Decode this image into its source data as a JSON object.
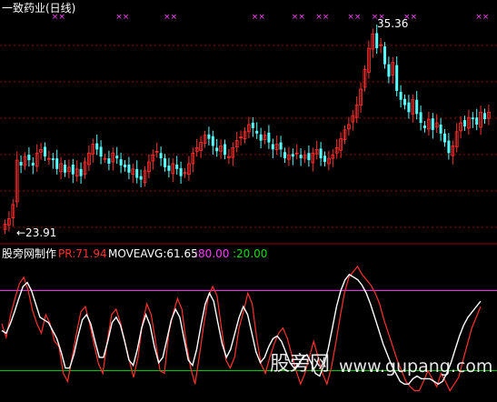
{
  "window": {
    "title": "一致药业(日线)"
  },
  "price_panel": {
    "high_label": "35.36",
    "low_label": "←23.91",
    "colors": {
      "up": "#ff3030",
      "down": "#54ffff",
      "grid": "#8b0000",
      "marker": "#ff40ff"
    }
  },
  "indicator_panel": {
    "name": "股旁网制作",
    "pr_text": "PR:71.94",
    "moveavg_text": "MOVEAVG:61.65",
    "level_high_text": ":80.00",
    "level_low_text": ":20.00",
    "colors": {
      "pr": "#ff3030",
      "moveavg": "#ffffff",
      "level_high": "#ff3cff",
      "level_low": "#00e000"
    }
  },
  "watermark": {
    "cn": "股旁网",
    "url": "www.gupang.com"
  },
  "chart_data": [
    {
      "type": "candlestick",
      "title": "一致药业(日线)",
      "ylim": [
        23.5,
        36.2
      ],
      "grid": true,
      "annotations": [
        {
          "text": "35.36",
          "kind": "high"
        },
        {
          "text": "←23.91",
          "kind": "low"
        }
      ],
      "signal_markers": "×× at top of panel",
      "series": [
        {
          "name": "close",
          "values": [
            24.3,
            24.6,
            25.4,
            27.9,
            27.6,
            28.1,
            27.9,
            27.6,
            28.3,
            28.5,
            28.1,
            28.0,
            27.9,
            27.4,
            27.7,
            27.2,
            27.5,
            27.1,
            27.4,
            27.0,
            27.8,
            28.3,
            28.8,
            28.5,
            28.1,
            28.0,
            27.7,
            28.3,
            28.0,
            27.6,
            27.5,
            27.2,
            27.4,
            26.9,
            26.8,
            27.3,
            27.8,
            28.2,
            28.4,
            28.0,
            27.5,
            27.3,
            27.7,
            27.4,
            27.0,
            27.2,
            27.7,
            28.3,
            28.6,
            28.9,
            29.3,
            29.1,
            28.7,
            28.4,
            28.7,
            28.2,
            28.1,
            28.6,
            29.0,
            29.2,
            29.5,
            29.9,
            29.7,
            29.4,
            29.0,
            29.3,
            28.9,
            28.5,
            28.8,
            28.5,
            28.0,
            28.2,
            28.1,
            28.3,
            28.0,
            28.2,
            27.9,
            28.3,
            28.5,
            28.0,
            27.8,
            28.0,
            28.2,
            28.6,
            29.1,
            29.6,
            29.9,
            30.4,
            31.0,
            31.9,
            33.0,
            34.2,
            35.0,
            34.2,
            34.4,
            33.3,
            32.6,
            33.4,
            31.8,
            31.3,
            31.0,
            30.6,
            31.3,
            30.5,
            30.0,
            29.7,
            30.2,
            29.6,
            30.0,
            29.4,
            28.9,
            28.3,
            28.7,
            29.5,
            30.0,
            29.8,
            30.3,
            30.2,
            29.9,
            30.6,
            30.2,
            30.6
          ]
        }
      ]
    },
    {
      "type": "line",
      "title": "股旁网制作",
      "ylim": [
        0,
        100
      ],
      "reference_lines": [
        80,
        20
      ],
      "series": [
        {
          "name": "PR",
          "values": [
            55,
            45,
            62,
            74,
            85,
            90,
            80,
            65,
            55,
            48,
            62,
            55,
            42,
            38,
            18,
            12,
            30,
            48,
            64,
            68,
            55,
            40,
            25,
            18,
            42,
            62,
            66,
            56,
            42,
            28,
            15,
            30,
            55,
            70,
            62,
            42,
            20,
            18,
            48,
            63,
            74,
            66,
            40,
            22,
            10,
            32,
            55,
            75,
            83,
            76,
            52,
            28,
            22,
            30,
            52,
            64,
            78,
            70,
            45,
            25,
            18,
            30,
            40,
            48,
            52,
            44,
            32,
            20,
            10,
            18,
            30,
            42,
            30,
            18,
            10,
            22,
            40,
            60,
            78,
            90,
            94,
            98,
            92,
            88,
            84,
            78,
            70,
            58,
            48,
            38,
            28,
            20,
            12,
            8,
            5,
            5,
            12,
            20,
            14,
            8,
            18,
            12,
            5,
            10,
            15,
            28,
            40,
            52,
            60,
            68
          ]
        },
        {
          "name": "MOVEAVG",
          "values": [
            50,
            48,
            55,
            64,
            74,
            83,
            86,
            80,
            70,
            60,
            58,
            56,
            50,
            44,
            34,
            22,
            22,
            32,
            46,
            58,
            62,
            55,
            42,
            30,
            30,
            42,
            56,
            60,
            54,
            42,
            28,
            24,
            36,
            52,
            62,
            54,
            38,
            26,
            30,
            44,
            58,
            66,
            60,
            44,
            28,
            24,
            36,
            54,
            70,
            78,
            72,
            56,
            40,
            30,
            36,
            48,
            60,
            68,
            62,
            48,
            34,
            26,
            30,
            38,
            44,
            46,
            42,
            34,
            26,
            22,
            24,
            30,
            32,
            26,
            18,
            16,
            24,
            36,
            52,
            68,
            80,
            88,
            92,
            90,
            88,
            84,
            78,
            70,
            60,
            50,
            40,
            32,
            24,
            18,
            12,
            10,
            10,
            14,
            16,
            14,
            14,
            14,
            12,
            10,
            12,
            18,
            26,
            36,
            46,
            54,
            60,
            64,
            68,
            71.94
          ]
        }
      ]
    }
  ]
}
